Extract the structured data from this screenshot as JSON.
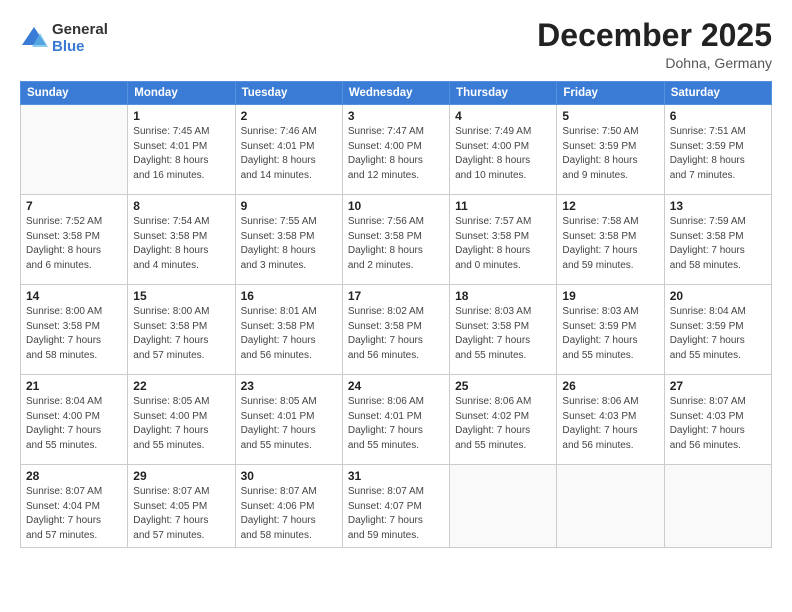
{
  "header": {
    "logo_general": "General",
    "logo_blue": "Blue",
    "month_title": "December 2025",
    "location": "Dohna, Germany"
  },
  "columns": [
    "Sunday",
    "Monday",
    "Tuesday",
    "Wednesday",
    "Thursday",
    "Friday",
    "Saturday"
  ],
  "weeks": [
    [
      {
        "day": "",
        "info": ""
      },
      {
        "day": "1",
        "info": "Sunrise: 7:45 AM\nSunset: 4:01 PM\nDaylight: 8 hours\nand 16 minutes."
      },
      {
        "day": "2",
        "info": "Sunrise: 7:46 AM\nSunset: 4:01 PM\nDaylight: 8 hours\nand 14 minutes."
      },
      {
        "day": "3",
        "info": "Sunrise: 7:47 AM\nSunset: 4:00 PM\nDaylight: 8 hours\nand 12 minutes."
      },
      {
        "day": "4",
        "info": "Sunrise: 7:49 AM\nSunset: 4:00 PM\nDaylight: 8 hours\nand 10 minutes."
      },
      {
        "day": "5",
        "info": "Sunrise: 7:50 AM\nSunset: 3:59 PM\nDaylight: 8 hours\nand 9 minutes."
      },
      {
        "day": "6",
        "info": "Sunrise: 7:51 AM\nSunset: 3:59 PM\nDaylight: 8 hours\nand 7 minutes."
      }
    ],
    [
      {
        "day": "7",
        "info": "Sunrise: 7:52 AM\nSunset: 3:58 PM\nDaylight: 8 hours\nand 6 minutes."
      },
      {
        "day": "8",
        "info": "Sunrise: 7:54 AM\nSunset: 3:58 PM\nDaylight: 8 hours\nand 4 minutes."
      },
      {
        "day": "9",
        "info": "Sunrise: 7:55 AM\nSunset: 3:58 PM\nDaylight: 8 hours\nand 3 minutes."
      },
      {
        "day": "10",
        "info": "Sunrise: 7:56 AM\nSunset: 3:58 PM\nDaylight: 8 hours\nand 2 minutes."
      },
      {
        "day": "11",
        "info": "Sunrise: 7:57 AM\nSunset: 3:58 PM\nDaylight: 8 hours\nand 0 minutes."
      },
      {
        "day": "12",
        "info": "Sunrise: 7:58 AM\nSunset: 3:58 PM\nDaylight: 7 hours\nand 59 minutes."
      },
      {
        "day": "13",
        "info": "Sunrise: 7:59 AM\nSunset: 3:58 PM\nDaylight: 7 hours\nand 58 minutes."
      }
    ],
    [
      {
        "day": "14",
        "info": "Sunrise: 8:00 AM\nSunset: 3:58 PM\nDaylight: 7 hours\nand 58 minutes."
      },
      {
        "day": "15",
        "info": "Sunrise: 8:00 AM\nSunset: 3:58 PM\nDaylight: 7 hours\nand 57 minutes."
      },
      {
        "day": "16",
        "info": "Sunrise: 8:01 AM\nSunset: 3:58 PM\nDaylight: 7 hours\nand 56 minutes."
      },
      {
        "day": "17",
        "info": "Sunrise: 8:02 AM\nSunset: 3:58 PM\nDaylight: 7 hours\nand 56 minutes."
      },
      {
        "day": "18",
        "info": "Sunrise: 8:03 AM\nSunset: 3:58 PM\nDaylight: 7 hours\nand 55 minutes."
      },
      {
        "day": "19",
        "info": "Sunrise: 8:03 AM\nSunset: 3:59 PM\nDaylight: 7 hours\nand 55 minutes."
      },
      {
        "day": "20",
        "info": "Sunrise: 8:04 AM\nSunset: 3:59 PM\nDaylight: 7 hours\nand 55 minutes."
      }
    ],
    [
      {
        "day": "21",
        "info": "Sunrise: 8:04 AM\nSunset: 4:00 PM\nDaylight: 7 hours\nand 55 minutes."
      },
      {
        "day": "22",
        "info": "Sunrise: 8:05 AM\nSunset: 4:00 PM\nDaylight: 7 hours\nand 55 minutes."
      },
      {
        "day": "23",
        "info": "Sunrise: 8:05 AM\nSunset: 4:01 PM\nDaylight: 7 hours\nand 55 minutes."
      },
      {
        "day": "24",
        "info": "Sunrise: 8:06 AM\nSunset: 4:01 PM\nDaylight: 7 hours\nand 55 minutes."
      },
      {
        "day": "25",
        "info": "Sunrise: 8:06 AM\nSunset: 4:02 PM\nDaylight: 7 hours\nand 55 minutes."
      },
      {
        "day": "26",
        "info": "Sunrise: 8:06 AM\nSunset: 4:03 PM\nDaylight: 7 hours\nand 56 minutes."
      },
      {
        "day": "27",
        "info": "Sunrise: 8:07 AM\nSunset: 4:03 PM\nDaylight: 7 hours\nand 56 minutes."
      }
    ],
    [
      {
        "day": "28",
        "info": "Sunrise: 8:07 AM\nSunset: 4:04 PM\nDaylight: 7 hours\nand 57 minutes."
      },
      {
        "day": "29",
        "info": "Sunrise: 8:07 AM\nSunset: 4:05 PM\nDaylight: 7 hours\nand 57 minutes."
      },
      {
        "day": "30",
        "info": "Sunrise: 8:07 AM\nSunset: 4:06 PM\nDaylight: 7 hours\nand 58 minutes."
      },
      {
        "day": "31",
        "info": "Sunrise: 8:07 AM\nSunset: 4:07 PM\nDaylight: 7 hours\nand 59 minutes."
      },
      {
        "day": "",
        "info": ""
      },
      {
        "day": "",
        "info": ""
      },
      {
        "day": "",
        "info": ""
      }
    ]
  ]
}
